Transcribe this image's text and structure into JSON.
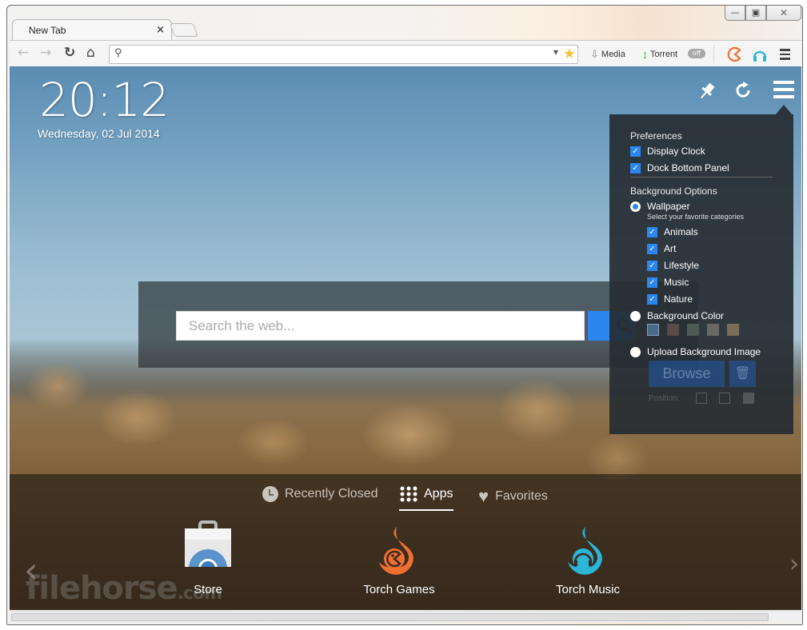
{
  "window": {
    "controls": {
      "minimize": "—",
      "maximize": "▣",
      "close": "✕"
    }
  },
  "tabs": [
    {
      "title": "New Tab",
      "active": true
    }
  ],
  "toolbar": {
    "omnibox_value": "",
    "omnibox_placeholder": "",
    "media_label": "Media",
    "torrent_label": "Torrent",
    "torrent_toggle": "off"
  },
  "clock": {
    "time": "20:12",
    "date": "Wednesday,  02 Jul 2014"
  },
  "search": {
    "placeholder": "Search the web..."
  },
  "settings": {
    "preferences_heading": "Preferences",
    "preferences": [
      {
        "label": "Display Clock",
        "checked": true
      },
      {
        "label": "Dock Bottom Panel",
        "checked": true
      }
    ],
    "background_heading": "Background Options",
    "wallpaper_label": "Wallpaper",
    "wallpaper_selected": true,
    "categories_hint": "Select your favorite categories",
    "categories": [
      {
        "label": "Animals",
        "checked": true
      },
      {
        "label": "Art",
        "checked": true
      },
      {
        "label": "Lifestyle",
        "checked": true
      },
      {
        "label": "Music",
        "checked": true
      },
      {
        "label": "Nature",
        "checked": true
      }
    ],
    "background_color_label": "Background Color",
    "color_swatches": [
      "#4a6a8a",
      "#5a4a48",
      "#4d5a55",
      "#6a6862",
      "#7a6e58"
    ],
    "upload_label": "Upload Background Image",
    "browse_label": "Browse",
    "position_label": "Position:"
  },
  "bottom_panel": {
    "tabs": [
      {
        "label": "Recently Closed",
        "icon": "clock-icon",
        "active": false
      },
      {
        "label": "Apps",
        "icon": "grid-icon",
        "active": true
      },
      {
        "label": "Favorites",
        "icon": "heart-icon",
        "active": false
      }
    ],
    "apps": [
      {
        "label": "Store",
        "icon": "chrome-store-icon"
      },
      {
        "label": "Torch Games",
        "icon": "torch-games-icon",
        "color": "#f07030"
      },
      {
        "label": "Torch Music",
        "icon": "torch-music-icon",
        "color": "#2bb5d6"
      }
    ],
    "watermark": "filehorse",
    "watermark_suffix": ".com"
  },
  "colors": {
    "accent": "#2b86f0",
    "games": "#f07030",
    "music": "#2bb5d6"
  }
}
